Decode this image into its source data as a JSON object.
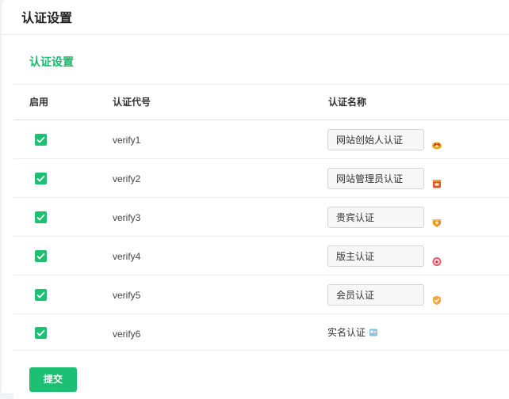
{
  "page": {
    "title": "认证设置"
  },
  "section": {
    "title": "认证设置"
  },
  "table": {
    "headers": {
      "enable": "启用",
      "code": "认证代号",
      "name": "认证名称"
    },
    "rows": [
      {
        "enabled": true,
        "code": "verify1",
        "name": "网站创始人认证",
        "icon": "crown-badge-icon"
      },
      {
        "enabled": true,
        "code": "verify2",
        "name": "网站管理员认证",
        "icon": "admin-badge-icon"
      },
      {
        "enabled": true,
        "code": "verify3",
        "name": "贵宾认证",
        "icon": "vip-badge-icon"
      },
      {
        "enabled": true,
        "code": "verify4",
        "name": "版主认证",
        "icon": "moderator-badge-icon"
      },
      {
        "enabled": true,
        "code": "verify5",
        "name": "会员认证",
        "icon": "member-badge-icon"
      },
      {
        "enabled": true,
        "code": "verify6",
        "name": "实名认证",
        "icon": "id-card-icon"
      }
    ]
  },
  "actions": {
    "submit_label": "提交"
  },
  "colors": {
    "accent": "#1dbf73",
    "section_title": "#19b86b"
  }
}
